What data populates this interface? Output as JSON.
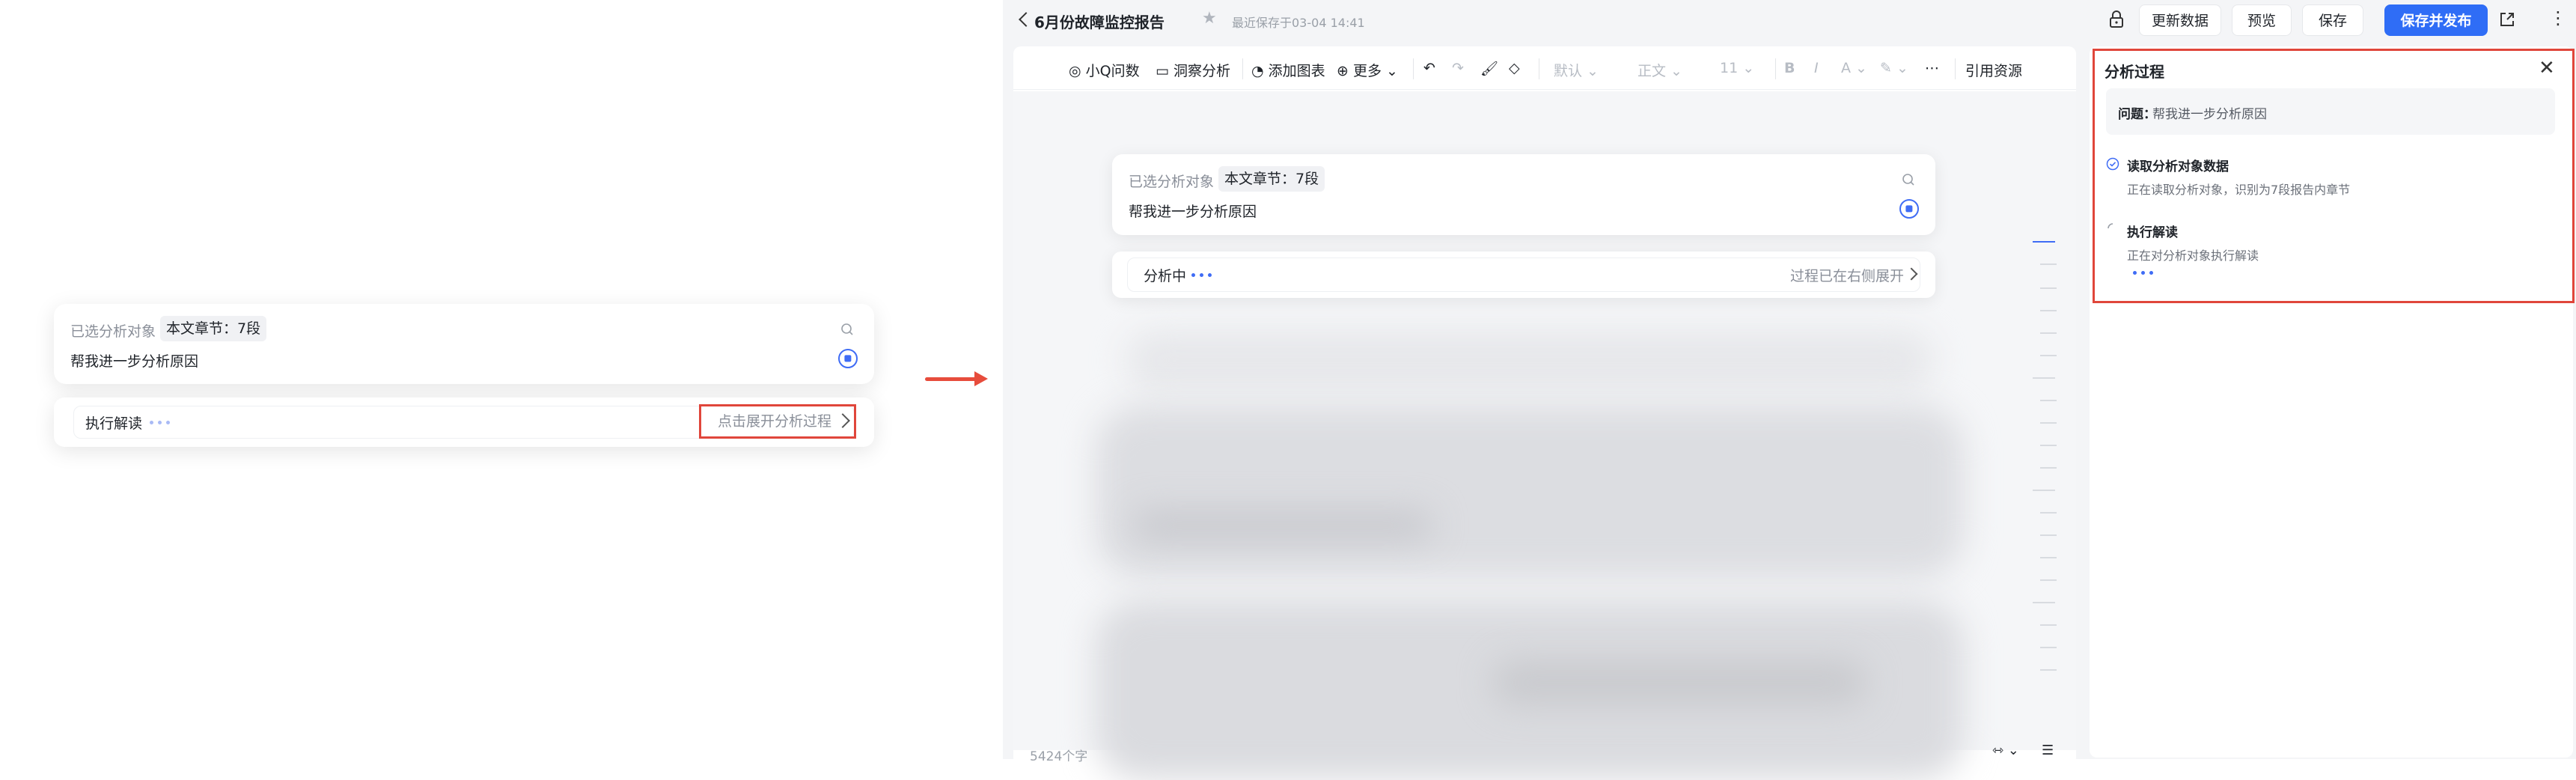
{
  "left_zoom": {
    "selected_label": "已选分析对象",
    "selected_chip": "本文章节：7段",
    "question": "帮我进一步分析原因",
    "status_text": "执行解读",
    "expand_label": "点击展开分析过程"
  },
  "header": {
    "title": "6月份故障监控报告",
    "saved": "最近保存于03-04 14:41",
    "update_data": "更新数据",
    "preview": "预览",
    "save": "保存",
    "save_publish": "保存并发布"
  },
  "toolbar": {
    "ask": "小Q问数",
    "insight": "洞察分析",
    "add_chart": "添加图表",
    "more": "更多",
    "font_default": "默认",
    "style_body": "正文",
    "size": "11",
    "cite": "引用资源"
  },
  "editor_card": {
    "selected_label": "已选分析对象",
    "selected_chip": "本文章节：7段",
    "question": "帮我进一步分析原因",
    "analyzing": "分析中",
    "expanded_hint": "过程已在右侧展开"
  },
  "status": {
    "word_count": "5424个字"
  },
  "panel": {
    "title": "分析过程",
    "question_key": "问题：",
    "question_value": "帮我进一步分析原因",
    "steps": [
      {
        "title": "读取分析对象数据",
        "desc": "正在读取分析对象，识别为7段报告内章节",
        "state": "done"
      },
      {
        "title": "执行解读",
        "desc": "正在对分析对象执行解读",
        "state": "running"
      }
    ]
  },
  "colors": {
    "accent": "#2f6df6",
    "highlight": "#e0463b",
    "arrow": "#e74c3c"
  }
}
